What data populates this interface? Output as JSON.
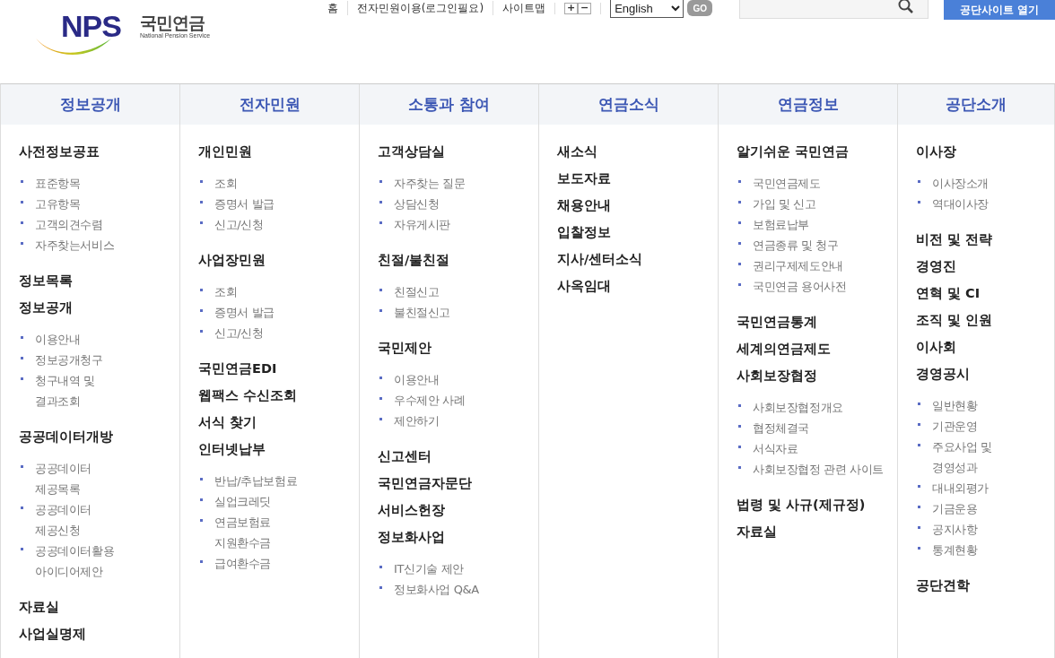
{
  "logo": {
    "mark": "NPS",
    "name": "국민연금",
    "subtitle": "National Pension Service"
  },
  "top_links": [
    {
      "label": "홈"
    },
    {
      "label": "전자민원이용(로그인필요)"
    },
    {
      "label": "사이트맵"
    }
  ],
  "font_size_buttons": [
    "+",
    "−"
  ],
  "language_select": {
    "value": "English"
  },
  "go_button": "GO",
  "site_button": "공단사이트 열기",
  "columns": [
    {
      "title": "정보공개",
      "groups": [
        {
          "heading": "사전정보공표",
          "items": [
            "표준항목",
            "고유항목",
            "고객의견수렴",
            "자주찾는서비스"
          ]
        },
        {
          "heading": "정보목록"
        },
        {
          "heading": "정보공개",
          "items": [
            "이용안내",
            "정보공개청구",
            "청구내역 및\n결과조회"
          ]
        },
        {
          "heading": "공공데이터개방",
          "items": [
            "공공데이터\n제공목록",
            "공공데이터\n제공신청",
            "공공데이터활용\n아이디어제안"
          ]
        },
        {
          "heading": "자료실"
        },
        {
          "heading": "사업실명제"
        }
      ]
    },
    {
      "title": "전자민원",
      "groups": [
        {
          "heading": "개인민원",
          "items": [
            "조회",
            "증명서 발급",
            "신고/신청"
          ]
        },
        {
          "heading": "사업장민원",
          "items": [
            "조회",
            "증명서 발급",
            "신고/신청"
          ]
        },
        {
          "heading": "국민연금EDI"
        },
        {
          "heading": "웹팩스 수신조회"
        },
        {
          "heading": "서식 찾기"
        },
        {
          "heading": "인터넷납부",
          "items": [
            "반납/추납보험료",
            "실업크레딧",
            "연금보험료\n지원환수금",
            "급여환수금"
          ]
        }
      ]
    },
    {
      "title": "소통과 참여",
      "groups": [
        {
          "heading": "고객상담실",
          "items": [
            "자주찾는 질문",
            "상담신청",
            "자유게시판"
          ]
        },
        {
          "heading": "친절/불친절",
          "items": [
            "친절신고",
            "불친절신고"
          ]
        },
        {
          "heading": "국민제안",
          "items": [
            "이용안내",
            "우수제안 사례",
            "제안하기"
          ]
        },
        {
          "heading": "신고센터"
        },
        {
          "heading": "국민연금자문단"
        },
        {
          "heading": "서비스헌장"
        },
        {
          "heading": "정보화사업",
          "items": [
            "IT신기술 제안",
            "정보화사업 Q&A"
          ]
        }
      ]
    },
    {
      "title": "연금소식",
      "groups": [
        {
          "heading": "새소식"
        },
        {
          "heading": "보도자료"
        },
        {
          "heading": "채용안내"
        },
        {
          "heading": "입찰정보"
        },
        {
          "heading": "지사/센터소식"
        },
        {
          "heading": "사옥임대"
        }
      ]
    },
    {
      "title": "연금정보",
      "groups": [
        {
          "heading": "알기쉬운 국민연금",
          "items": [
            "국민연금제도",
            "가입 및 신고",
            "보험료납부",
            "연금종류 및 청구",
            "권리구제제도안내",
            "국민연금 용어사전"
          ]
        },
        {
          "heading": "국민연금통계"
        },
        {
          "heading": "세계의연금제도"
        },
        {
          "heading": "사회보장협정",
          "items": [
            "사회보장협정개요",
            "협정체결국",
            "서식자료",
            "사회보장협정 관련 사이트"
          ]
        },
        {
          "heading": "법령 및 사규(제규정)"
        },
        {
          "heading": "자료실"
        }
      ]
    },
    {
      "title": "공단소개",
      "groups": [
        {
          "heading": "이사장",
          "items": [
            "이사장소개",
            "역대이사장"
          ]
        },
        {
          "heading": "비전 및 전략"
        },
        {
          "heading": "경영진"
        },
        {
          "heading": "연혁 및 CI"
        },
        {
          "heading": "조직 및 인원"
        },
        {
          "heading": "이사회"
        },
        {
          "heading": "경영공시",
          "items": [
            "일반현황",
            "기관운영",
            "주요사업 및\n경영성과",
            "대내외평가",
            "기금운용",
            "공지사항",
            "통계현황"
          ]
        },
        {
          "heading": "공단견학"
        }
      ]
    }
  ]
}
